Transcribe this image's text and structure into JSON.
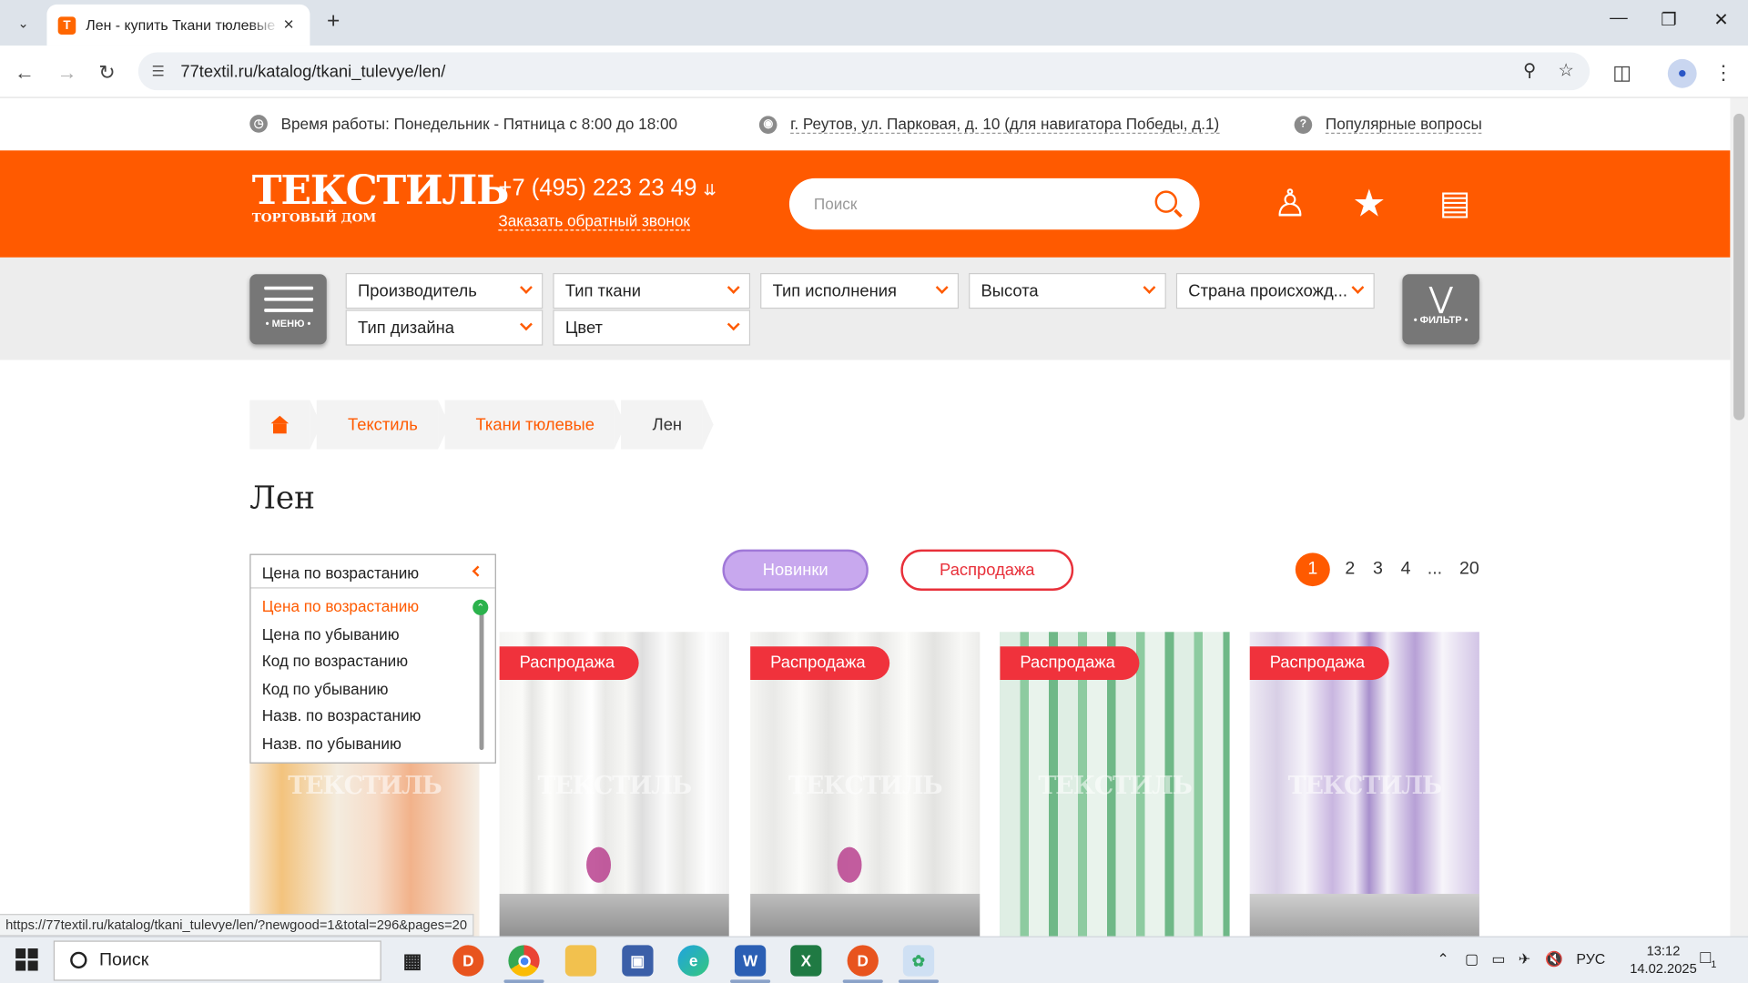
{
  "browser": {
    "tab_title": "Лен - купить Ткани тюлевые о",
    "url": "77textil.ru/katalog/tkani_tulevye/len/",
    "status_url": "https://77textil.ru/katalog/tkani_tulevye/len/?newgood=1&total=296&pages=20"
  },
  "topinfo": {
    "hours": "Время работы: Понедельник - Пятница с 8:00 до 18:00",
    "address": "г. Реутов, ул. Парковая, д. 10 (для навигатора Победы, д.1)",
    "faq": "Популярные вопросы"
  },
  "header": {
    "logo_big": "ТЕКСТИЛЬ",
    "logo_small": "ТОРГОВЫЙ ДОМ",
    "phone": "+7 (495) 223 23 49",
    "callback": "Заказать обратный звонок",
    "search_placeholder": "Поиск"
  },
  "filters": {
    "menu_label": "• МЕНЮ •",
    "filter_label": "• ФИЛЬТР •",
    "row1": [
      "Производитель",
      "Тип ткани",
      "Тип исполнения",
      "Высота",
      "Страна происхожд..."
    ],
    "row2": [
      "Тип дизайна",
      "Цвет"
    ]
  },
  "breadcrumbs": [
    "Текстиль",
    "Ткани тюлевые",
    "Лен"
  ],
  "page_title": "Лен",
  "sort": {
    "selected": "Цена по возрастанию",
    "options": [
      "Цена по возрастанию",
      "Цена по убыванию",
      "Код по возрастанию",
      "Код по убыванию",
      "Назв. по возрастанию",
      "Назв. по убыванию"
    ]
  },
  "pills": {
    "new": "Новинки",
    "sale": "Распродажа"
  },
  "pagination": [
    "1",
    "2",
    "3",
    "4",
    "...",
    "20"
  ],
  "products": [
    {
      "badge": "",
      "watermark": "ТЕКСТИЛЬ"
    },
    {
      "badge": "Распродажа",
      "watermark": "ТЕКСТИЛЬ"
    },
    {
      "badge": "Распродажа",
      "watermark": "ТЕКСТИЛЬ"
    },
    {
      "badge": "Распродажа",
      "watermark": "ТЕКСТИЛЬ"
    },
    {
      "badge": "Распродажа",
      "watermark": "ТЕКСТИЛЬ"
    }
  ],
  "taskbar": {
    "search": "Поиск",
    "lang": "РУС",
    "time": "13:12",
    "date": "14.02.2025",
    "notif": "1"
  },
  "colors": {
    "brand": "#ff5a00",
    "sale": "#f0323c",
    "new": "#c8a8ee"
  }
}
